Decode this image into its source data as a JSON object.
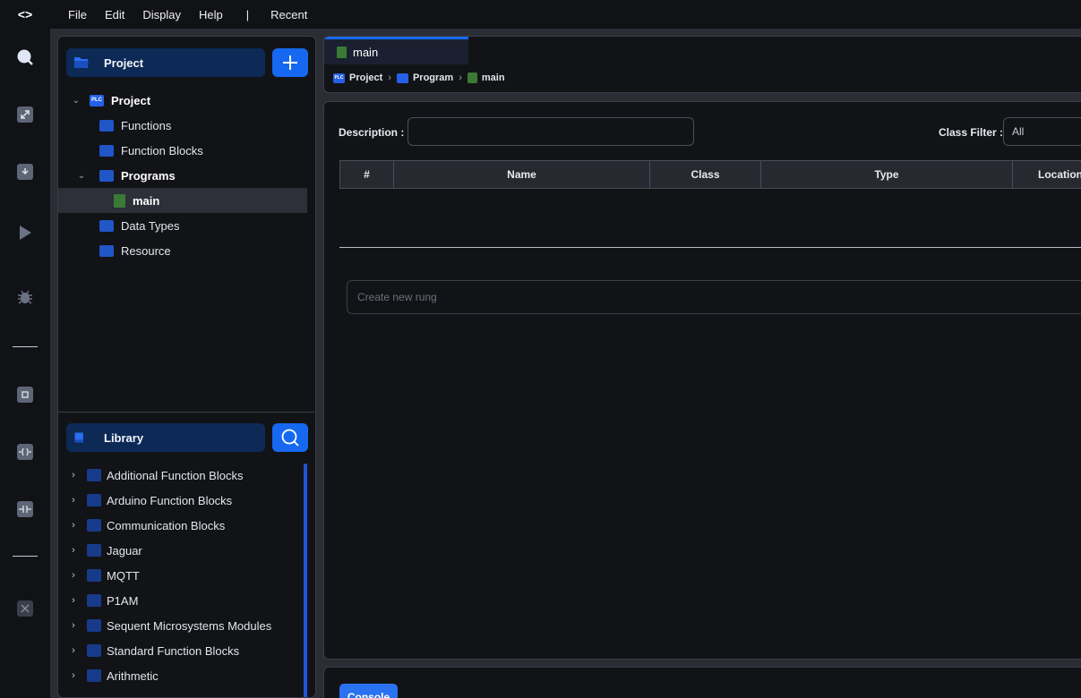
{
  "menu": {
    "logo": "<>",
    "items": [
      "File",
      "Edit",
      "Display",
      "Help"
    ],
    "separator": "|",
    "recent": "Recent"
  },
  "activity_bar": {
    "icons": [
      "search-icon",
      "zoom-icon",
      "download-icon",
      "play-icon",
      "debug-icon",
      "chip-icon",
      "coil-icon",
      "contact-icon",
      "close-icon"
    ]
  },
  "project_panel": {
    "title": "Project",
    "add_button_icon": "plus-icon",
    "tree": [
      {
        "label": "Project",
        "icon_text": "PLC"
      },
      {
        "label": "Functions"
      },
      {
        "label": "Function Blocks"
      },
      {
        "label": "Programs"
      },
      {
        "label": "main"
      },
      {
        "label": "Data Types"
      },
      {
        "label": "Resource"
      }
    ]
  },
  "library_panel": {
    "title": "Library",
    "search_button_icon": "search-icon",
    "items": [
      "Additional Function Blocks",
      "Arduino Function Blocks",
      "Communication Blocks",
      "Jaguar",
      "MQTT",
      "P1AM",
      "Sequent Microsystems Modules",
      "Standard Function Blocks",
      "Arithmetic"
    ]
  },
  "tabs": [
    {
      "label": "main"
    }
  ],
  "breadcrumb": [
    "Project",
    "Program",
    "main"
  ],
  "editor": {
    "description_label": "Description :",
    "description_value": "",
    "class_filter_label": "Class Filter :",
    "class_filter_value": "All",
    "table_headers": [
      "#",
      "Name",
      "Class",
      "Type",
      "Location"
    ],
    "new_rung_placeholder": "Create new rung"
  },
  "console": {
    "button_label": "Console"
  },
  "colors": {
    "accent": "#1668f0",
    "panel_bg": "#121317",
    "header_bg": "#0d2a57"
  }
}
